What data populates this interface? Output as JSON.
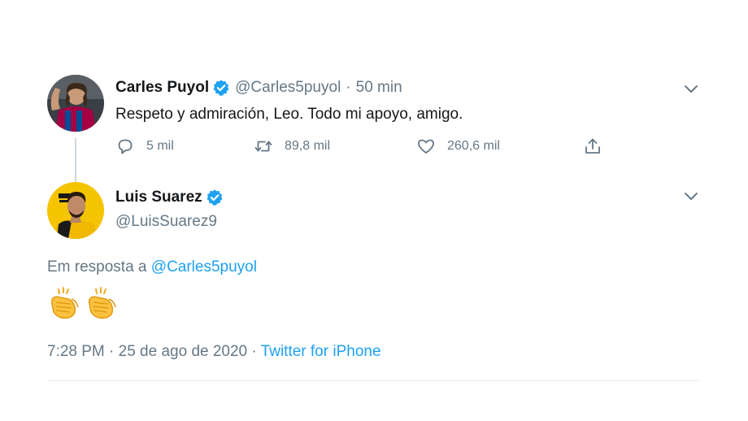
{
  "tweet_parent": {
    "display_name": "Carles Puyol",
    "handle": "@Carles5puyol",
    "separator": "·",
    "time_ago": "50 min",
    "text": "Respeto y admiración, Leo. Todo mi apoyo, amigo.",
    "actions": {
      "reply_count": "5 mil",
      "retweet_count": "89,8 mil",
      "like_count": "260,6 mil"
    }
  },
  "tweet_main": {
    "display_name": "Luis Suarez",
    "handle": "@LuisSuarez9",
    "reply_prefix": "Em resposta a",
    "reply_handle": "@Carles5puyol",
    "emoji_text": "👏👏",
    "timestamp": "7:28 PM · 25 de ago de 2020 ·",
    "source": "Twitter for iPhone"
  },
  "colors": {
    "accent": "#1da1f2",
    "verified": "#1da1f2",
    "secondary_text": "#657786",
    "primary_text": "#14171a"
  },
  "icons": {
    "verified": "verified-badge-icon",
    "menu": "chevron-down-icon",
    "reply": "reply-icon",
    "retweet": "retweet-icon",
    "like": "heart-icon",
    "share": "share-icon"
  }
}
